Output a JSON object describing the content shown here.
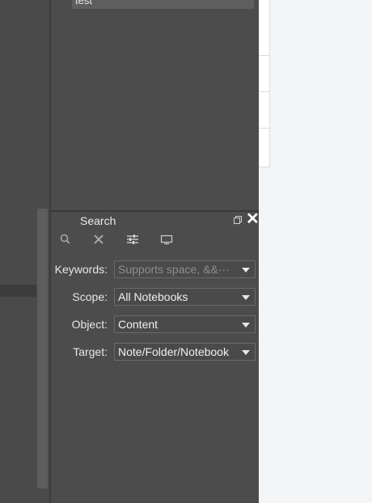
{
  "notebook_list": {
    "selected_item": "test"
  },
  "search_panel": {
    "title": "Search",
    "toolbar": [
      {
        "name": "search-icon"
      },
      {
        "name": "clear-icon"
      },
      {
        "name": "advanced-settings-icon"
      },
      {
        "name": "display-icon"
      }
    ],
    "fields": {
      "keywords": {
        "label": "Keywords:",
        "placeholder": "Supports space, &&···"
      },
      "scope": {
        "label": "Scope:",
        "value": "All Notebooks"
      },
      "object": {
        "label": "Object:",
        "value": "Content"
      },
      "target": {
        "label": "Target:",
        "value": "Note/Folder/Notebook"
      }
    }
  }
}
